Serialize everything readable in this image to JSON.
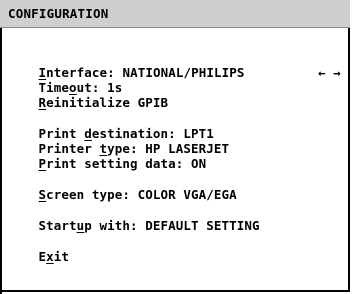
{
  "title": "CONFIGURATION",
  "menu": {
    "interface": {
      "pre": "",
      "hot": "I",
      "post": "nterface:",
      "value": "NATIONAL/PHILIPS"
    },
    "timeout": {
      "pre": "Time",
      "hot": "o",
      "post": "ut: 1s"
    },
    "reinit": {
      "pre": "",
      "hot": "R",
      "post": "einitialize GPIB"
    },
    "print_dest": {
      "pre": "Print ",
      "hot": "d",
      "post": "estination: LPT1"
    },
    "printer_type": {
      "pre": "Printer ",
      "hot": "t",
      "post": "ype: HP LASERJET"
    },
    "print_setting": {
      "pre": "",
      "hot": "P",
      "post": "rint setting data: ON"
    },
    "screen_type": {
      "pre": "",
      "hot": "S",
      "post": "creen type: COLOR VGA/EGA"
    },
    "startup": {
      "pre": "Start",
      "hot": "u",
      "post": "p with: DEFAULT SETTING"
    },
    "exit": {
      "pre": "E",
      "hot": "x",
      "post": "it"
    }
  },
  "arrows": "← →",
  "icons": [
    "left-arrow-icon",
    "right-arrow-icon"
  ]
}
